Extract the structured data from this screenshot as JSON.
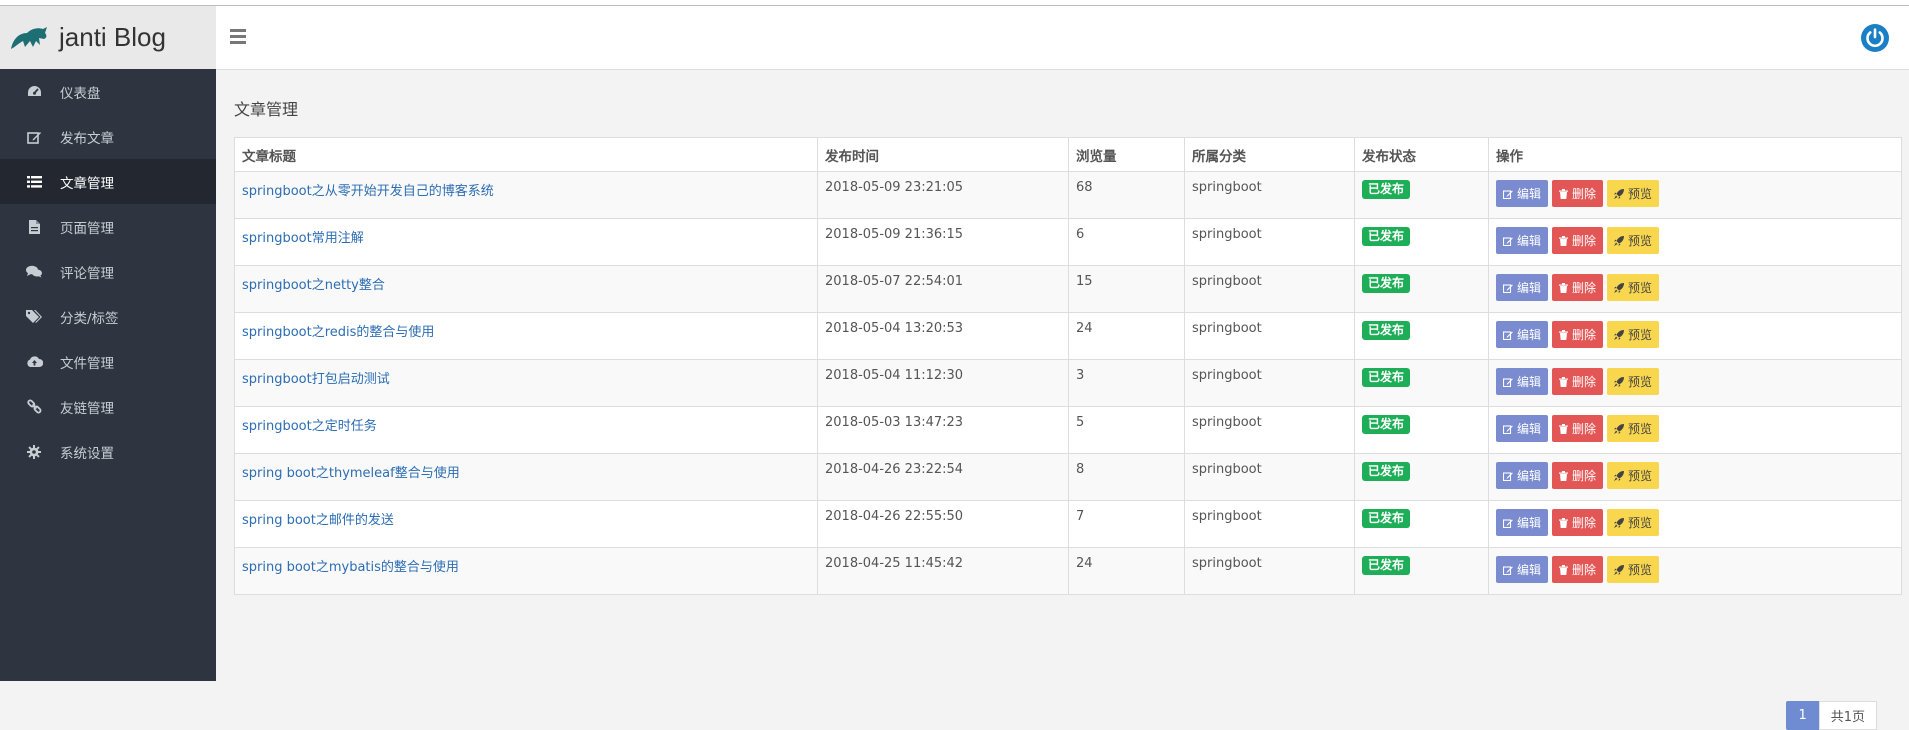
{
  "app": {
    "brand": "janti Blog"
  },
  "sidebar": {
    "items": [
      {
        "label": "仪表盘",
        "icon": "dashboard-icon"
      },
      {
        "label": "发布文章",
        "icon": "edit-icon"
      },
      {
        "label": "文章管理",
        "icon": "list-icon",
        "active": true
      },
      {
        "label": "页面管理",
        "icon": "file-icon"
      },
      {
        "label": "评论管理",
        "icon": "comments-icon"
      },
      {
        "label": "分类/标签",
        "icon": "tags-icon"
      },
      {
        "label": "文件管理",
        "icon": "cloud-upload-icon"
      },
      {
        "label": "友链管理",
        "icon": "link-icon"
      },
      {
        "label": "系统设置",
        "icon": "gear-icon"
      }
    ]
  },
  "main": {
    "title": "文章管理",
    "columns": [
      "文章标题",
      "发布时间",
      "浏览量",
      "所属分类",
      "发布状态",
      "操作"
    ],
    "actions": {
      "edit": "编辑",
      "delete": "删除",
      "preview": "预览"
    },
    "rows": [
      {
        "title": "springboot之从零开始开发自己的博客系统",
        "time": "2018-05-09 23:21:05",
        "views": "68",
        "category": "springboot",
        "status": "已发布"
      },
      {
        "title": "springboot常用注解",
        "time": "2018-05-09 21:36:15",
        "views": "6",
        "category": "springboot",
        "status": "已发布"
      },
      {
        "title": "springboot之netty整合",
        "time": "2018-05-07 22:54:01",
        "views": "15",
        "category": "springboot",
        "status": "已发布"
      },
      {
        "title": "springboot之redis的整合与使用",
        "time": "2018-05-04 13:20:53",
        "views": "24",
        "category": "springboot",
        "status": "已发布"
      },
      {
        "title": "springboot打包启动测试",
        "time": "2018-05-04 11:12:30",
        "views": "3",
        "category": "springboot",
        "status": "已发布"
      },
      {
        "title": "springboot之定时任务",
        "time": "2018-05-03 13:47:23",
        "views": "5",
        "category": "springboot",
        "status": "已发布"
      },
      {
        "title": "spring boot之thymeleaf整合与使用",
        "time": "2018-04-26 23:22:54",
        "views": "8",
        "category": "springboot",
        "status": "已发布"
      },
      {
        "title": "spring boot之邮件的发送",
        "time": "2018-04-26 22:55:50",
        "views": "7",
        "category": "springboot",
        "status": "已发布"
      },
      {
        "title": "spring boot之mybatis的整合与使用",
        "time": "2018-04-25 11:45:42",
        "views": "24",
        "category": "springboot",
        "status": "已发布"
      }
    ]
  },
  "pagination": {
    "current": "1",
    "total": "共1页"
  },
  "colors": {
    "sidebar": "#2f3540",
    "badge": "#1fae58",
    "edit": "#7a8ccf",
    "delete": "#e35656",
    "preview": "#f8d64e",
    "power": "#1a7fc4"
  }
}
